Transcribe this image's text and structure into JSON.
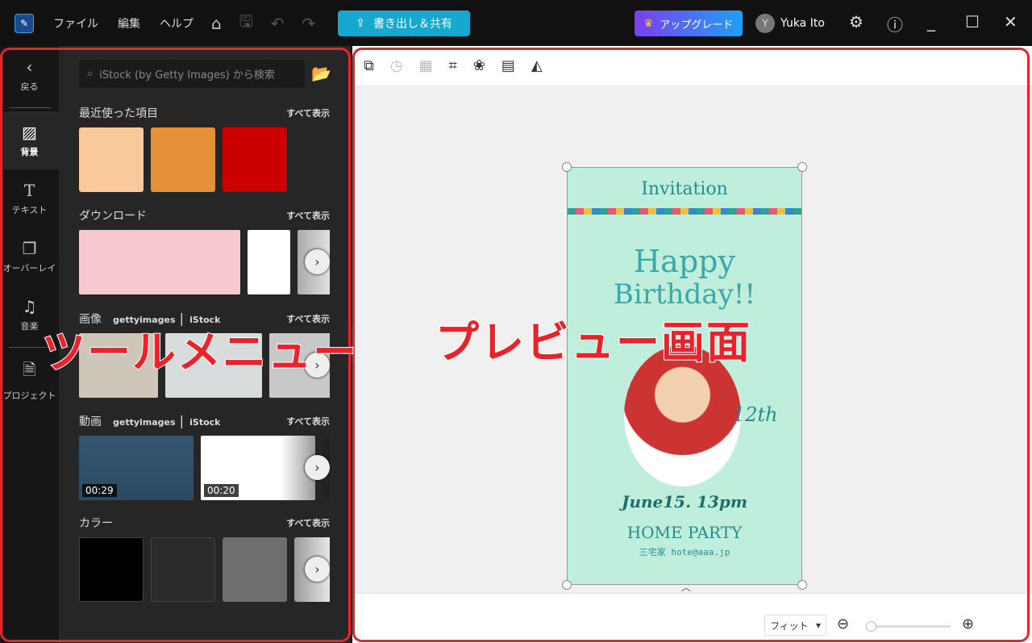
{
  "topbar": {
    "menus": [
      "ファイル",
      "編集",
      "ヘルプ"
    ],
    "export_label": "書き出し＆共有",
    "upgrade_label": "アップグレード",
    "user_initial": "Y",
    "user_name": "Yuka Ito"
  },
  "rail": {
    "back": "戻る",
    "items": [
      {
        "label": "背景",
        "icon": "background-icon",
        "active": true
      },
      {
        "label": "テキスト",
        "icon": "text-icon"
      },
      {
        "label": "オーバーレイ",
        "icon": "overlay-icon"
      },
      {
        "label": "音楽",
        "icon": "music-icon"
      },
      {
        "label": "プロジェクト",
        "icon": "project-icon"
      }
    ]
  },
  "panel": {
    "search_placeholder": "iStock (by Getty Images) から検索",
    "show_all": "すべて表示",
    "recent": {
      "title": "最近使った項目",
      "colors": [
        "#f9c99b",
        "#e5913a",
        "#cc0000"
      ]
    },
    "download": {
      "title": "ダウンロード"
    },
    "images": {
      "title": "画像",
      "brand1": "gettyimages",
      "brand2": "iStock"
    },
    "videos": {
      "title": "動画",
      "brand1": "gettyimages",
      "brand2": "iStock",
      "durations": [
        "00:29",
        "00:20"
      ]
    },
    "color": {
      "title": "カラー",
      "colors": [
        "#000000",
        "#2b2b2b",
        "#6e6e6e"
      ]
    }
  },
  "preview": {
    "card": {
      "title": "Invitation",
      "headline1": "Happy",
      "headline2": "Birthday!!",
      "age": "12th",
      "date": "June15. 13pm",
      "event": "HOME PARTY",
      "contact": "三宅家 hote@aaa.jp"
    },
    "zoom_mode": "フィット",
    "zoom_level": 0
  },
  "annotations": {
    "left": "ツールメニュー",
    "right": "プレビュー画面",
    "color": "#e8232b"
  }
}
